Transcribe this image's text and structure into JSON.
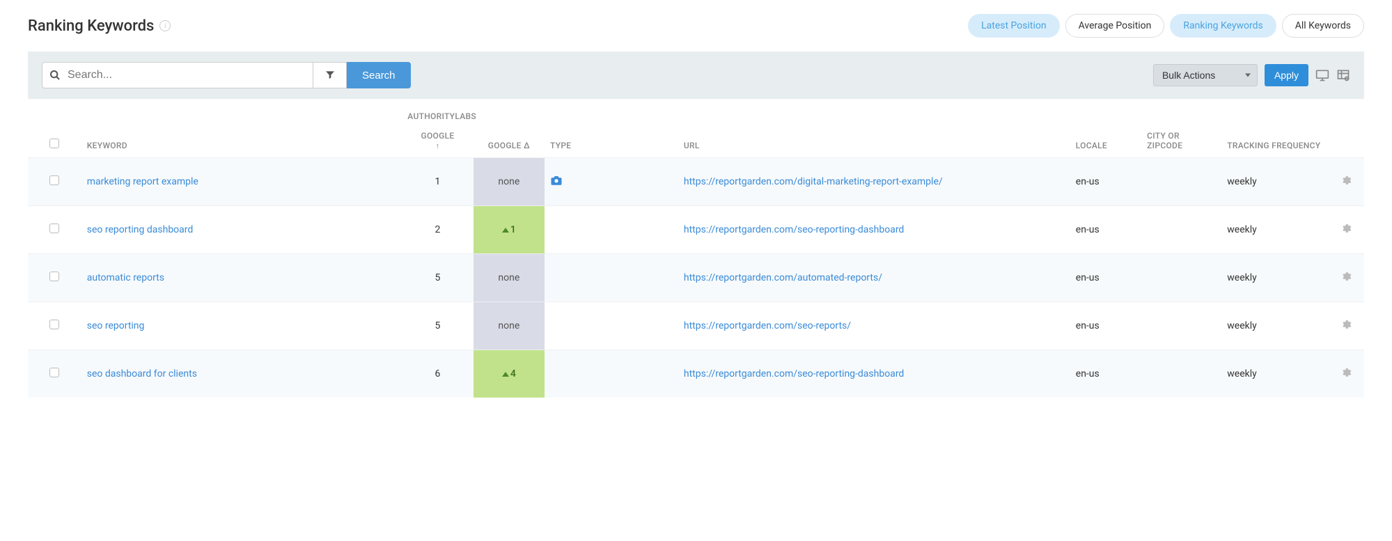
{
  "title": "Ranking Keywords",
  "pills": [
    {
      "label": "Latest Position",
      "active": true
    },
    {
      "label": "Average Position",
      "active": false
    },
    {
      "label": "Ranking Keywords",
      "active": true
    },
    {
      "label": "All Keywords",
      "active": false
    }
  ],
  "toolbar": {
    "search_placeholder": "Search...",
    "search_button": "Search",
    "bulk_actions_label": "Bulk Actions",
    "apply_label": "Apply"
  },
  "columns": {
    "group": "AUTHORITYLABS",
    "keyword": "KEYWORD",
    "google": "GOOGLE",
    "google_sort": "↑",
    "google_delta": "GOOGLE Δ",
    "type": "TYPE",
    "url": "URL",
    "locale": "LOCALE",
    "city": "CITY OR ZIPCODE",
    "freq": "TRACKING FREQUENCY"
  },
  "rows": [
    {
      "keyword": "marketing report example",
      "google": "1",
      "delta_type": "none",
      "delta_value": "none",
      "has_camera": true,
      "url": "https://reportgarden.com/digital-marketing-report-example/",
      "locale": "en-us",
      "city": "",
      "freq": "weekly"
    },
    {
      "keyword": "seo reporting dashboard",
      "google": "2",
      "delta_type": "up",
      "delta_value": "1",
      "has_camera": false,
      "url": "https://reportgarden.com/seo-reporting-dashboard",
      "locale": "en-us",
      "city": "",
      "freq": "weekly"
    },
    {
      "keyword": "automatic reports",
      "google": "5",
      "delta_type": "none",
      "delta_value": "none",
      "has_camera": false,
      "url": "https://reportgarden.com/automated-reports/",
      "locale": "en-us",
      "city": "",
      "freq": "weekly"
    },
    {
      "keyword": "seo reporting",
      "google": "5",
      "delta_type": "none",
      "delta_value": "none",
      "has_camera": false,
      "url": "https://reportgarden.com/seo-reports/",
      "locale": "en-us",
      "city": "",
      "freq": "weekly"
    },
    {
      "keyword": "seo dashboard for clients",
      "google": "6",
      "delta_type": "up",
      "delta_value": "4",
      "has_camera": false,
      "url": "https://reportgarden.com/seo-reporting-dashboard",
      "locale": "en-us",
      "city": "",
      "freq": "weekly"
    }
  ]
}
